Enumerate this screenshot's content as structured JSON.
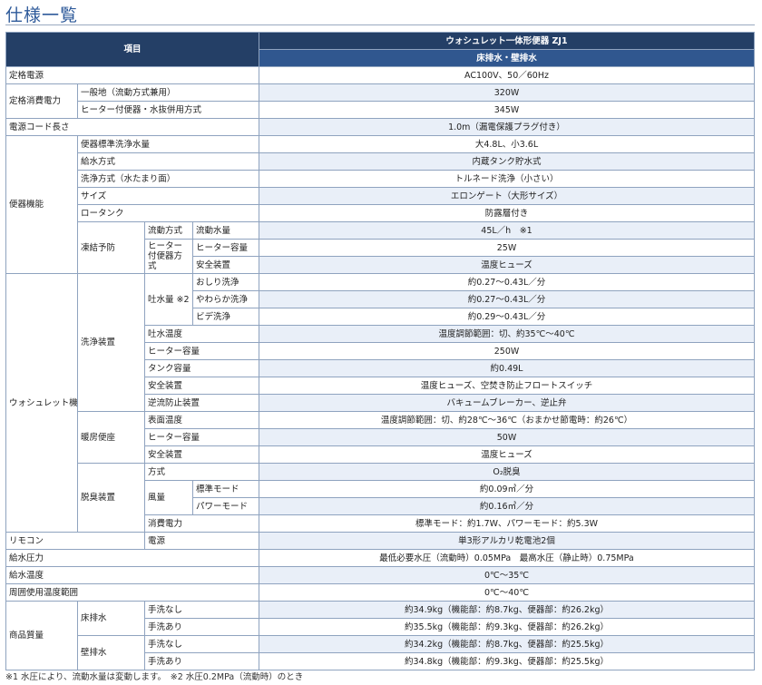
{
  "title": "仕様一覧",
  "header": {
    "item": "項目",
    "product": "ウォシュレット一体形便器 ZJ1",
    "drain": "床排水・壁排水"
  },
  "rows": {
    "rated_power": {
      "label": "定格電源",
      "value": "AC100V、50／60Hz"
    },
    "rated_consumption": {
      "label": "定格消費電力",
      "general": {
        "label": "一般地（流動方式兼用）",
        "value": "320W"
      },
      "heater": {
        "label": "ヒーター付便器・水抜併用方式",
        "value": "345W"
      }
    },
    "cord": {
      "label": "電源コード長さ",
      "value": "1.0m（漏電保護プラグ付き）"
    },
    "toilet": {
      "label": "便器機能",
      "flush_volume": {
        "label": "便器標準洗浄水量",
        "value": "大4.8L、小3.6L"
      },
      "water_supply": {
        "label": "給水方式",
        "value": "内蔵タンク貯水式"
      },
      "flush_method": {
        "label": "洗浄方式（水たまり面）",
        "value": "トルネード洗浄（小さい）"
      },
      "size": {
        "label": "サイズ",
        "value": "エロンゲート（大形サイズ）"
      },
      "low_tank": {
        "label": "ロータンク",
        "value": "防露層付き"
      },
      "freeze": {
        "label": "凍結予防",
        "flow": {
          "label": "流動方式",
          "sub": "流動水量",
          "value": "45L／h　※1"
        },
        "heater_method": {
          "label": "ヒーター付便器方式"
        },
        "heater_capacity": {
          "label": "ヒーター容量",
          "value": "25W"
        },
        "safety": {
          "label": "安全装置",
          "value": "温度ヒューズ"
        }
      }
    },
    "washlet": {
      "label": "ウォシュレット機能",
      "wash": {
        "label": "洗浄装置",
        "spray": {
          "label": "吐水量 ※2",
          "oshiri": {
            "label": "おしり洗浄",
            "value": "約0.27～0.43L／分"
          },
          "yawaraka": {
            "label": "やわらか洗浄",
            "value": "約0.27～0.43L／分"
          },
          "bidet": {
            "label": "ビデ洗浄",
            "value": "約0.29～0.43L／分"
          }
        },
        "temp": {
          "label": "吐水温度",
          "value": "温度調節範囲：切、約35℃～40℃"
        },
        "heater": {
          "label": "ヒーター容量",
          "value": "250W"
        },
        "tank": {
          "label": "タンク容量",
          "value": "約0.49L"
        },
        "safety": {
          "label": "安全装置",
          "value": "温度ヒューズ、空焚き防止フロートスイッチ"
        },
        "backflow": {
          "label": "逆流防止装置",
          "value": "バキュームブレーカー、逆止弁"
        }
      },
      "seat": {
        "label": "暖房便座",
        "surface": {
          "label": "表面温度",
          "value": "温度調節範囲：切、約28℃～36℃（おまかせ節電時：約26℃）"
        },
        "heater": {
          "label": "ヒーター容量",
          "value": "50W"
        },
        "safety": {
          "label": "安全装置",
          "value": "温度ヒューズ"
        }
      },
      "deodor": {
        "label": "脱臭装置",
        "method": {
          "label": "方式",
          "value": "O₂脱臭"
        },
        "airflow": {
          "label": "風量",
          "standard": {
            "label": "標準モード",
            "value": "約0.09㎥／分"
          },
          "power": {
            "label": "パワーモード",
            "value": "約0.16㎥／分"
          }
        },
        "consumption": {
          "label": "消費電力",
          "value": "標準モード：約1.7W、パワーモード：約5.3W"
        }
      }
    },
    "remote": {
      "label": "リモコン",
      "sub": "電源",
      "value": "単3形アルカリ乾電池2個"
    },
    "pressure": {
      "label": "給水圧力",
      "value": "最低必要水圧（流動時）0.05MPa　最高水圧（静止時）0.75MPa"
    },
    "water_temp": {
      "label": "給水温度",
      "value": "0℃～35℃"
    },
    "ambient": {
      "label": "周囲使用温度範囲",
      "value": "0℃～40℃"
    },
    "weight": {
      "label": "商品質量",
      "floor": {
        "label": "床排水",
        "no_wash": {
          "label": "手洗なし",
          "value": "約34.9kg（機能部：約8.7kg、便器部：約26.2kg）"
        },
        "wash": {
          "label": "手洗あり",
          "value": "約35.5kg（機能部：約9.3kg、便器部：約26.2kg）"
        }
      },
      "wall": {
        "label": "壁排水",
        "no_wash": {
          "label": "手洗なし",
          "value": "約34.2kg（機能部：約8.7kg、便器部：約25.5kg）"
        },
        "wash": {
          "label": "手洗あり",
          "value": "約34.8kg（機能部：約9.3kg、便器部：約25.5kg）"
        }
      }
    }
  },
  "footnote": "※1 水圧により、流動水量は変動します。　※2 水圧0.2MPa（流動時）のとき",
  "colors": {
    "header": "#243f66",
    "header2": "#30578f",
    "stripe": "#e9eff8",
    "border": "#8fa3bf",
    "title": "#2e5a9a"
  }
}
